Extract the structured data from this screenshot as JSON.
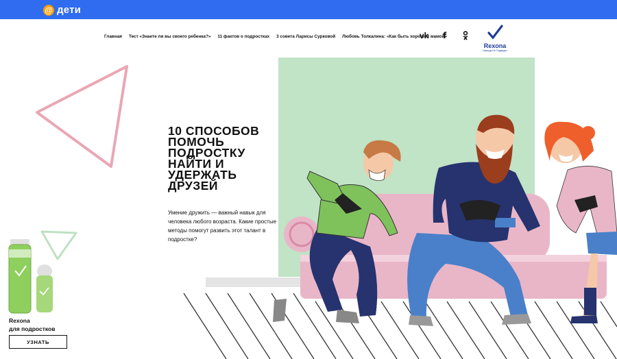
{
  "header": {
    "logo_symbol": "@",
    "logo_text": "дети",
    "bar_color": "#2f6cf0",
    "logo_accent": "#ff9e00"
  },
  "nav": {
    "items": [
      {
        "label": "Главная"
      },
      {
        "label": "Тест «Знаете ли вы своего ребенка?»"
      },
      {
        "label": "11 фактов о подростках"
      },
      {
        "label": "3 совета Ларисы Сурковой"
      },
      {
        "label": "Любовь Толкалина: «Как быть хорошей мамой»"
      }
    ]
  },
  "social": {
    "vk": "vk",
    "facebook": "f",
    "odnoklassniki": "ok"
  },
  "brand": {
    "name": "Rexona",
    "tagline": "Никогда Не Подведет"
  },
  "hero": {
    "headline_lines": [
      "10 СПОСОБОВ",
      "ПОМОЧЬ",
      "ПОДРОСТКУ",
      "НАЙТИ И",
      "УДЕРЖАТЬ",
      "ДРУЗЕЙ"
    ],
    "lead": "Умение дружить — важный навык для человека любого возраста. Какие простые методы помогут развить этот талант в подростке?"
  },
  "ad": {
    "title_line1": "Rexona",
    "title_line2": "для подростков",
    "button_label": "УЗНАТЬ",
    "product_label": "Rexona"
  },
  "colors": {
    "backdrop_green": "#c1e3c6",
    "sofa_pink": "#e9b6c8",
    "triangle_pink": "#eaa6b4",
    "triangle_green": "#bfe0c3",
    "beard": "#9b3e1d",
    "hair_orange": "#ee5f2c",
    "navy": "#26336e",
    "jeans": "#4a80c9",
    "shirt_green": "#7fc25c"
  }
}
